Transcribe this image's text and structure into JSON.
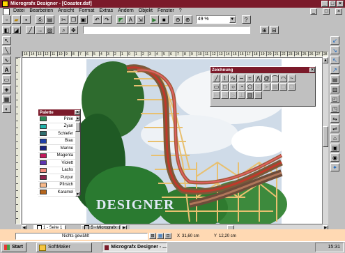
{
  "window": {
    "title": "Micrografx Designer - [Coaster.dsf]",
    "controls": [
      "_",
      "□",
      "×"
    ],
    "doc_controls": [
      "_",
      "□",
      "×"
    ]
  },
  "menu": [
    "Datei",
    "Bearbeiten",
    "Ansicht",
    "Format",
    "Extras",
    "Ändern",
    "Objekt",
    "Fenster",
    "?"
  ],
  "toolbar": {
    "zoom_value": "49 %",
    "help_icon": "?"
  },
  "rulers": {
    "h_ticks": [
      "15",
      "14",
      "13",
      "12",
      "11",
      "10",
      "9",
      "8",
      "7",
      "6",
      "5",
      "4",
      "3",
      "2",
      "1",
      "0",
      "1",
      "2",
      "3",
      "4",
      "5",
      "6",
      "7",
      "8",
      "9",
      "10",
      "11",
      "12",
      "13",
      "14",
      "15",
      "16",
      "17",
      "18",
      "19",
      "20",
      "21",
      "22",
      "23",
      "24",
      "25",
      "26",
      "27",
      "28",
      "29",
      "30",
      "31",
      "32"
    ]
  },
  "palette": {
    "title": "Palette",
    "colors": [
      {
        "name": "Pinie",
        "hex": "#2e8b57"
      },
      {
        "name": "Zyan",
        "hex": "#20b2aa"
      },
      {
        "name": "Schiefer",
        "hex": "#2f6f6f"
      },
      {
        "name": "Blau",
        "hex": "#1f3fa8"
      },
      {
        "name": "Marine",
        "hex": "#1a237e"
      },
      {
        "name": "Magenta",
        "hex": "#c2185b"
      },
      {
        "name": "Violett",
        "hex": "#5e35b1"
      },
      {
        "name": "Lachs",
        "hex": "#f48a7a"
      },
      {
        "name": "Purpur",
        "hex": "#8e244d"
      },
      {
        "name": "Pfirsich",
        "hex": "#f7b98a"
      },
      {
        "name": "Karamel",
        "hex": "#b5651d"
      }
    ]
  },
  "zeichnung": {
    "title": "Zeichnung"
  },
  "artwork": {
    "logo_text": "DESIGNER"
  },
  "doc_tabs": {
    "page_tab": "1 - Seite 1",
    "layer_tab": "5 - Micrografx"
  },
  "statusbar": {
    "status_text": "Nichts gewählt",
    "x_label": "X",
    "x_value": "31,60 cm",
    "y_label": "Y",
    "y_value": "12,20 cm"
  },
  "taskbar": {
    "start_label": "Start",
    "tasks": [
      "SoftMaker",
      "Micrografx Designer - ..."
    ],
    "clock": "15:31"
  },
  "colors": {
    "titlebar": "#7b1a2a",
    "highlight_bar": "#ffd9b3",
    "taskbar": "#c0c0c0"
  }
}
